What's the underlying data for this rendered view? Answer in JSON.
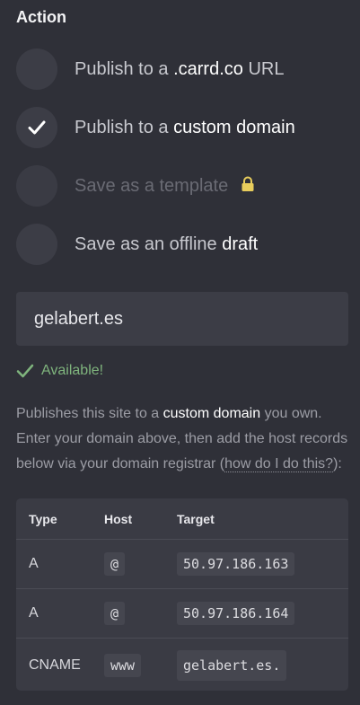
{
  "section": {
    "title": "Action"
  },
  "options": [
    {
      "prefix": "Publish to a ",
      "highlight": ".carrd.co",
      "suffix": " URL",
      "selected": false,
      "disabled": false
    },
    {
      "prefix": "Publish to a ",
      "highlight": "custom domain",
      "suffix": "",
      "selected": true,
      "disabled": false
    },
    {
      "prefix": "Save as a template",
      "highlight": "",
      "suffix": "",
      "selected": false,
      "disabled": true
    },
    {
      "prefix": "Save as an offline ",
      "highlight": "draft",
      "suffix": "",
      "selected": false,
      "disabled": false
    }
  ],
  "domain_input": {
    "value": "gelabert.es"
  },
  "status": {
    "text": "Available!"
  },
  "description": {
    "part1": "Publishes this site to a ",
    "highlight": "custom domain",
    "part2": " you own. Enter your domain above, then add the host records below via your domain registrar (",
    "link": "how do I do this?",
    "part3": "):"
  },
  "records": {
    "headers": [
      "Type",
      "Host",
      "Target"
    ],
    "rows": [
      {
        "type": "A",
        "host": "@",
        "target": "50.97.186.163"
      },
      {
        "type": "A",
        "host": "@",
        "target": "50.97.186.164"
      },
      {
        "type": "CNAME",
        "host": "www",
        "target": "gelabert.es."
      }
    ]
  },
  "colors": {
    "background": "#2f3038",
    "available_green": "#7fb47d",
    "lock_yellow": "#e8cd5c"
  },
  "icons": {
    "selected": "checkmark-icon",
    "locked": "lock-icon",
    "available": "checkmark-icon"
  }
}
